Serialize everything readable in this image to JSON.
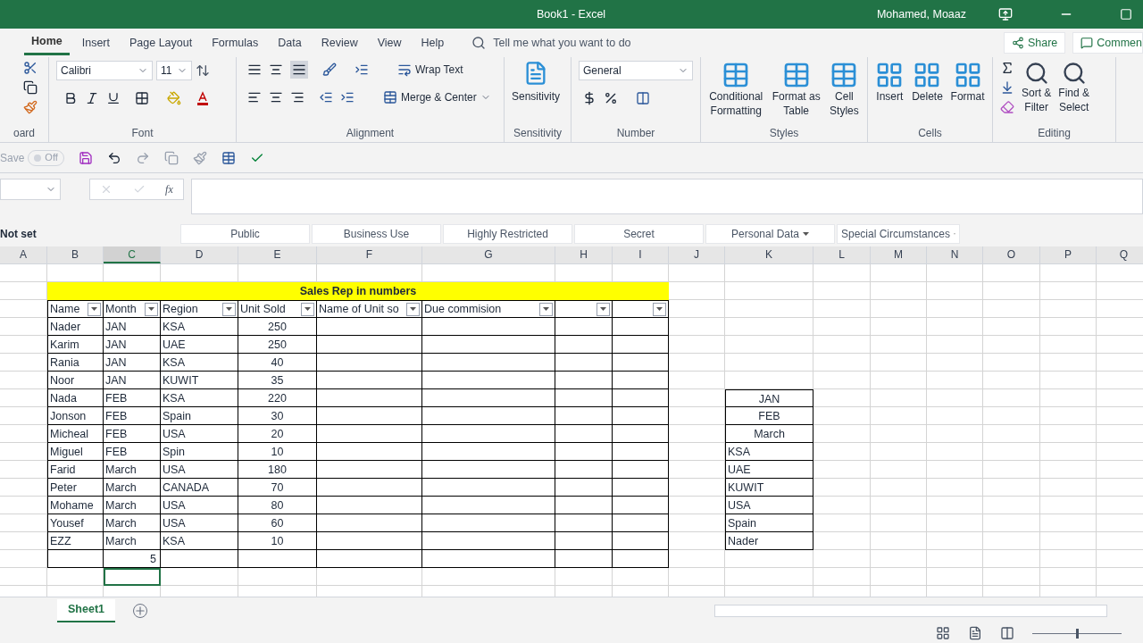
{
  "title_bar": {
    "title": "Book1  -  Excel",
    "user": "Mohamed, Moaaz"
  },
  "menu_tabs": [
    {
      "label": "Home",
      "selected": true
    },
    {
      "label": "Insert",
      "selected": false
    },
    {
      "label": "Page Layout",
      "selected": false
    },
    {
      "label": "Formulas",
      "selected": false
    },
    {
      "label": "Data",
      "selected": false
    },
    {
      "label": "Review",
      "selected": false
    },
    {
      "label": "View",
      "selected": false
    },
    {
      "label": "Help",
      "selected": false
    }
  ],
  "tell_me": "Tell me what you want to do",
  "share": "Share",
  "comments": "Commen",
  "ribbon": {
    "clipboard": {
      "label": "oard"
    },
    "font": {
      "label": "Font",
      "font_name": "Calibri",
      "font_size": "11"
    },
    "alignment": {
      "label": "Alignment",
      "wrap_text": "Wrap Text",
      "merge": "Merge & Center"
    },
    "sensitivity": {
      "label": "Sensitivity",
      "button": "Sensitivity"
    },
    "number": {
      "label": "Number",
      "format": "General"
    },
    "styles": {
      "label": "Styles",
      "buttons": [
        [
          "Conditional",
          "Formatting"
        ],
        [
          "Format as",
          "Table"
        ],
        [
          "Cell",
          "Styles"
        ]
      ]
    },
    "cells": {
      "label": "Cells",
      "buttons": [
        "Insert",
        "Delete",
        "Format"
      ]
    },
    "editing": {
      "label": "Editing",
      "buttons": [
        [
          "Sort &",
          "Filter"
        ],
        [
          "Find &",
          "Select"
        ]
      ]
    }
  },
  "quick_access": {
    "autosave": "Save",
    "toggle": "Off",
    "autosave_on": false
  },
  "sensitivity_bar": {
    "status": "Not set",
    "labels": [
      {
        "label": "Public",
        "dropdown": false
      },
      {
        "label": "Business Use",
        "dropdown": false
      },
      {
        "label": "Highly Restricted",
        "dropdown": false
      },
      {
        "label": "Secret",
        "dropdown": false
      },
      {
        "label": "Personal Data",
        "dropdown": true
      },
      {
        "label": "Special Circumstances",
        "dropdown": true
      }
    ]
  },
  "columns": [
    {
      "label": "A",
      "selected": false
    },
    {
      "label": "B",
      "selected": false
    },
    {
      "label": "C",
      "selected": true
    },
    {
      "label": "D",
      "selected": false
    },
    {
      "label": "E",
      "selected": false
    },
    {
      "label": "F",
      "selected": false
    },
    {
      "label": "G",
      "selected": false
    },
    {
      "label": "H",
      "selected": false
    },
    {
      "label": "I",
      "selected": false
    },
    {
      "label": "J",
      "selected": false
    },
    {
      "label": "K",
      "selected": false
    },
    {
      "label": "L",
      "selected": false
    },
    {
      "label": "M",
      "selected": false
    },
    {
      "label": "N",
      "selected": false
    },
    {
      "label": "O",
      "selected": false
    },
    {
      "label": "P",
      "selected": false
    },
    {
      "label": "Q",
      "selected": false
    }
  ],
  "table": {
    "title": "Sales Rep in numbers",
    "headers": [
      {
        "label": "Name",
        "filter": true
      },
      {
        "label": "Month",
        "filter": true
      },
      {
        "label": "Region",
        "filter": true
      },
      {
        "label": "Unit Sold",
        "filter": true
      },
      {
        "label": "Name of Unit so",
        "filter": true
      },
      {
        "label": "Due commision",
        "filter": true
      },
      {
        "filter": true
      },
      {
        "filter": true
      }
    ],
    "rows": [
      [
        "Nader",
        "JAN",
        "KSA",
        "250"
      ],
      [
        "Karim",
        "JAN",
        "UAE",
        "250"
      ],
      [
        "Rania",
        "JAN",
        "KSA",
        "40"
      ],
      [
        "Noor",
        "JAN",
        "KUWIT",
        "35"
      ],
      [
        "Nada",
        "FEB",
        "KSA",
        "220"
      ],
      [
        "Jonson",
        "FEB",
        "Spain",
        "30"
      ],
      [
        "Micheal",
        "FEB",
        "USA",
        "20"
      ],
      [
        "Miguel",
        "FEB",
        "Spin",
        "10"
      ],
      [
        "Farid",
        "March",
        "USA",
        "180"
      ],
      [
        "Peter",
        "March",
        "CANADA",
        "70"
      ],
      [
        "Mohame",
        "March",
        "USA",
        "80"
      ],
      [
        "Yousef",
        "March",
        "USA",
        "60"
      ],
      [
        "EZZ",
        "March",
        "KSA",
        "10"
      ]
    ],
    "total_row": {
      "month": "5"
    }
  },
  "formula_bar": {
    "function_label": "fx"
  },
  "side_list": [
    {
      "text": "JAN",
      "centered": true
    },
    {
      "text": "FEB",
      "centered": true
    },
    {
      "text": "March",
      "centered": true
    },
    {
      "text": "KSA",
      "centered": false
    },
    {
      "text": "UAE",
      "centered": false
    },
    {
      "text": "KUWIT",
      "centered": false
    },
    {
      "text": "USA",
      "centered": false
    },
    {
      "text": "Spain",
      "centered": false
    },
    {
      "text": "Nader",
      "centered": false
    }
  ],
  "zoom": {
    "level": 0.5
  },
  "sheet_tabs": [
    {
      "label": "Sheet1",
      "selected": true
    }
  ]
}
